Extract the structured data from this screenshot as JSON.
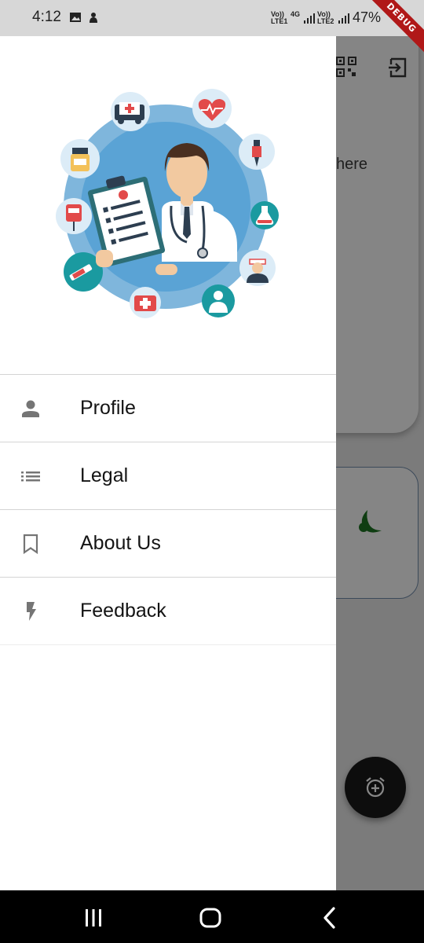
{
  "status_bar": {
    "time": "4:12",
    "network1_top": "Vo))",
    "network1_bottom": "LTE1",
    "network1_gen": "4G",
    "network2_top": "Vo))",
    "network2_bottom": "LTE2",
    "battery": "47%"
  },
  "debug_banner": "DEBUG",
  "background_app": {
    "partial_text": "here"
  },
  "drawer": {
    "menu": [
      {
        "label": "Profile",
        "icon": "person-icon"
      },
      {
        "label": "Legal",
        "icon": "list-icon"
      },
      {
        "label": "About Us",
        "icon": "bookmark-icon"
      },
      {
        "label": "Feedback",
        "icon": "flash-icon"
      }
    ]
  },
  "colors": {
    "drawer_bg": "#ffffff",
    "scrim": "#7b7b7b",
    "hero_circle": "#7fb6dc",
    "icon_grey": "#757575",
    "fab": "#0d0d0d",
    "debug": "#b01818"
  }
}
